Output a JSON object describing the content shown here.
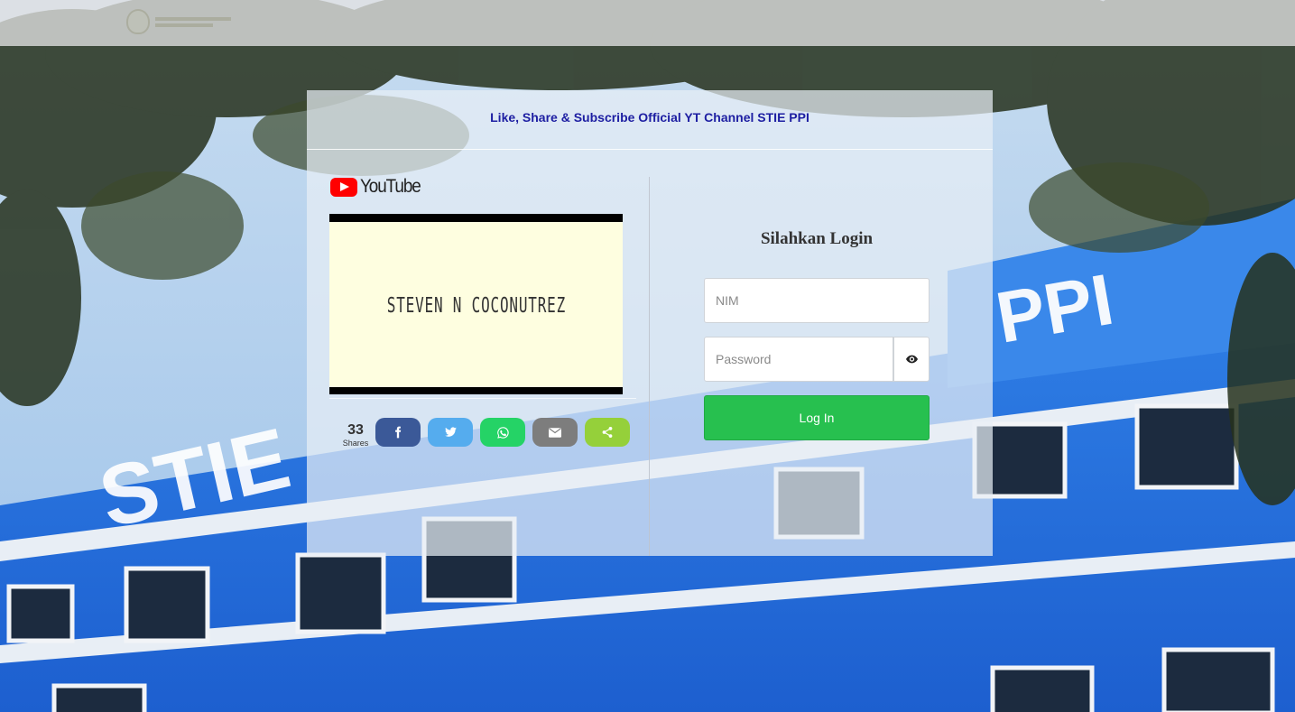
{
  "page": {
    "promo_text": "Like, Share & Subscribe Official YT Channel STIE PPI"
  },
  "video": {
    "provider": "YouTube",
    "title_card": "STEVEN N COCONUTREZ"
  },
  "share": {
    "count": "33",
    "count_label": "Shares",
    "buttons": [
      {
        "name": "facebook",
        "icon": "facebook-icon",
        "color": "#3b5998"
      },
      {
        "name": "twitter",
        "icon": "twitter-icon",
        "color": "#55acee"
      },
      {
        "name": "whatsapp",
        "icon": "whatsapp-icon",
        "color": "#25d366"
      },
      {
        "name": "email",
        "icon": "email-icon",
        "color": "#7d7d7d"
      },
      {
        "name": "sharethis",
        "icon": "share-icon",
        "color": "#95d03a"
      }
    ]
  },
  "login": {
    "title": "Silahkan Login",
    "nim_placeholder": "NIM",
    "password_placeholder": "Password",
    "submit_label": "Log In",
    "submit_color": "#27c04f"
  }
}
